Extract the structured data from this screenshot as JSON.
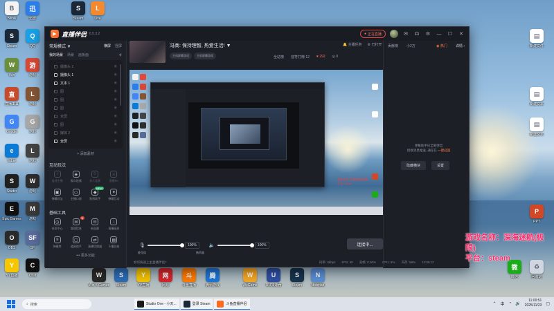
{
  "app": {
    "title": "直播伴侣",
    "version": "6.5.3.2",
    "live_button": "正在直播",
    "right_top_links": [
      "主播任务",
      "已打开"
    ],
    "mode_label": "常规模式 ▼",
    "mode_links": [
      "横屏",
      "竖屏"
    ],
    "scene_tabs": [
      "我的场景",
      "场景",
      "画板面"
    ],
    "sources": [
      {
        "label": "摄像头 2",
        "active": false
      },
      {
        "label": "摄像头 1",
        "active": true
      },
      {
        "label": "文本 1",
        "active": true
      },
      {
        "label": "图",
        "active": false
      },
      {
        "label": "图",
        "active": false
      },
      {
        "label": "图",
        "active": false
      },
      {
        "label": "全屏",
        "active": false
      },
      {
        "label": "图",
        "active": false
      },
      {
        "label": "媒体 2",
        "active": false
      },
      {
        "label": "全屏",
        "active": true
      }
    ],
    "add_source": "+ 添加素材",
    "interact_title": "互动玩法",
    "interact_items": [
      {
        "label": "连线主播",
        "icon": "mic-icon",
        "dim": true
      },
      {
        "label": "观众连线",
        "icon": "shield-icon",
        "dim": false
      },
      {
        "label": "多人连麦",
        "icon": "people-icon",
        "dim": true
      },
      {
        "label": "直播PK",
        "icon": "pk-icon",
        "dim": true
      },
      {
        "label": "弹幕玩法",
        "icon": "game-icon",
        "dim": false
      },
      {
        "label": "主播口袋",
        "icon": "chat-icon",
        "dim": false
      },
      {
        "label": "贴纸助手",
        "icon": "gift-icon",
        "dim": false,
        "badge": "NEW"
      },
      {
        "label": "弹幕互动",
        "icon": "star-icon",
        "dim": false
      }
    ],
    "tools_title": "基础工具",
    "tool_items": [
      {
        "label": "任务中心",
        "icon": "clock-icon"
      },
      {
        "label": "管理信息",
        "icon": "mail-icon",
        "badge": "5"
      },
      {
        "label": "粉丝群",
        "icon": "group-icon"
      },
      {
        "label": "直播画质",
        "icon": "download-icon"
      },
      {
        "label": "弹幕库",
        "icon": "list-icon"
      },
      {
        "label": "道具助手",
        "icon": "box-icon"
      },
      {
        "label": "直播切换器",
        "icon": "switch-icon"
      },
      {
        "label": "下播总结",
        "icon": "doc-icon"
      }
    ],
    "more_tools": "••• 更多功能",
    "room_title": "冯商: 保持理智, 热爱生活! ▼",
    "room_tags": [
      "主机屏幕游戏",
      "主机屏幕游戏"
    ],
    "top_actions": [
      "全站榜"
    ],
    "stats": [
      {
        "text": "音符打榜 12",
        "red": false
      },
      {
        "text": "♥ 292",
        "red": true
      },
      {
        "text": "◎ 0",
        "red": false
      }
    ],
    "right_header": [
      "贡献榜",
      "小2万"
    ],
    "right_hot": "◉ 热门",
    "right_detail": "详情 ›",
    "tip_lines": [
      "弹幕助手已全部弹出",
      "接收消息推送, 通在在"
    ],
    "tip_link": "一键召回",
    "tip_buttons": [
      "隐藏横块",
      "设置"
    ],
    "mic_pct": "100%",
    "spk_pct": "100%",
    "mic_label": "麦克风",
    "spk_label": "扬声器",
    "bottom_tools": [
      "美颜",
      "录制",
      "设置"
    ],
    "connect_label": "连接中...",
    "status_left": "如何快速上主直播伴侣?",
    "status_right": [
      "码率: 0kbps",
      "FPS: 60",
      "丢帧: 0.00%",
      "CPU: 5%",
      "内存: 58%",
      "12:09:12"
    ]
  },
  "preview_overlay": "游戏名称: 深海迷航(极限)\n平台: steam",
  "overlay": {
    "line1": "游戏名称：深海迷航(极限)",
    "line2": "平台：steam"
  },
  "desktop_icons_left": [
    {
      "label": "Bilibili",
      "color": "#f3f3f3",
      "text": "B"
    },
    {
      "label": "Steam",
      "color": "#1b2838",
      "text": "S"
    },
    {
      "label": "Win",
      "color": "#6b8e3a",
      "text": "W"
    },
    {
      "label": "直播工具",
      "color": "#c74a2a",
      "text": "直"
    },
    {
      "label": "Google",
      "color": "#4285f4",
      "text": "G"
    },
    {
      "label": "Edge",
      "color": "#0c7bd6",
      "text": "e"
    },
    {
      "label": "Studio",
      "color": "#202020",
      "text": "S"
    },
    {
      "label": "Epic Games",
      "color": "#111",
      "text": "E"
    },
    {
      "label": "OBS",
      "color": "#2a2a2a",
      "text": "O"
    },
    {
      "label": "YY直播",
      "color": "#f6c700",
      "text": "Y"
    }
  ],
  "desktop_icons_col2": [
    {
      "label": "迅雷",
      "color": "#2b7de9",
      "text": "迅"
    },
    {
      "label": "QQ",
      "color": "#1aa1e6",
      "text": "Q"
    },
    {
      "label": "游戏",
      "color": "#d94836",
      "text": "游"
    },
    {
      "label": "游戏",
      "color": "#845634",
      "text": "L"
    },
    {
      "label": "游戏",
      "color": "#a8a8a8",
      "text": "G"
    },
    {
      "label": "游戏",
      "color": "#444",
      "text": "L"
    },
    {
      "label": "游戏",
      "color": "#2d2d2d",
      "text": "W"
    },
    {
      "label": "游戏",
      "color": "#3a3a3a",
      "text": "M"
    },
    {
      "label": "SF",
      "color": "#5a6c9c",
      "text": "SF"
    },
    {
      "label": "Chat",
      "color": "#111",
      "text": "C"
    }
  ],
  "desktop_icons_top": [
    {
      "label": "Steam",
      "color": "#1b2838",
      "text": "S"
    },
    {
      "label": "Live",
      "color": "#f48a2f",
      "text": "L"
    }
  ],
  "desktop_icons_right": [
    {
      "label": "新建文件",
      "color": "#ffffff",
      "text": "▤"
    },
    {
      "label": "新建文本",
      "color": "#ffffff",
      "text": "▤"
    },
    {
      "label": "新建文本",
      "color": "#ffffff",
      "text": "▤"
    },
    {
      "label": "PPT",
      "color": "#d24726",
      "text": "P"
    },
    {
      "label": "微信",
      "color": "#1aad19",
      "text": "微"
    },
    {
      "label": "回收站",
      "color": "#d0d6df",
      "text": "♻"
    }
  ],
  "desktop_icons_bottom": [
    {
      "label": "Win 8 Games",
      "color": "#2a2a2a",
      "text": "W"
    },
    {
      "label": "Steam",
      "color": "#2d6cb5",
      "text": "S"
    },
    {
      "label": "YY直播",
      "color": "#f2c300",
      "text": "Y"
    },
    {
      "label": "网易",
      "color": "#d6252b",
      "text": "网"
    },
    {
      "label": "斗鱼直播",
      "color": "#ff7a00",
      "text": "斗"
    },
    {
      "label": "腾讯游戏",
      "color": "#1d76d6",
      "text": "腾"
    },
    {
      "label": "WeGame",
      "color": "#f5a623",
      "text": "W"
    },
    {
      "label": "UU加速器",
      "color": "#2f4fa3",
      "text": "U"
    },
    {
      "label": "Steam",
      "color": "#17344f",
      "text": "S"
    },
    {
      "label": "Notepad",
      "color": "#5a8fd6",
      "text": "N"
    }
  ],
  "taskbar": {
    "search_placeholder": "搜索",
    "apps": [
      {
        "label": "Studio One - 小天...",
        "color": "#1a1a1a",
        "open": true
      },
      {
        "label": "登录 Steam",
        "color": "#1b2838",
        "open": true
      },
      {
        "label": "斗鱼直播伴侣",
        "color": "#ff6a1f",
        "open": true
      }
    ],
    "time": "11:00:51",
    "date": "2025/11/23",
    "lang": "中"
  }
}
